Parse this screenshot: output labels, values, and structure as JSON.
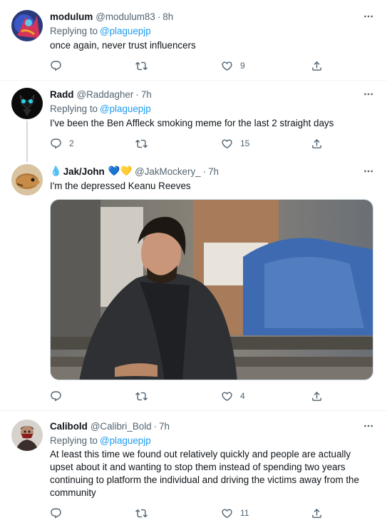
{
  "tweets": [
    {
      "name": "modulum",
      "handle": "@modulum83",
      "time": "8h",
      "replying_prefix": "Replying to",
      "replying_to": "@plaguepjp",
      "text": "once again, never trust influencers",
      "replies": "",
      "retweets": "",
      "likes": "9"
    },
    {
      "name": "Radd",
      "handle": "@Raddagher",
      "time": "7h",
      "replying_prefix": "Replying to",
      "replying_to": "@plaguepjp",
      "text": "I've been the Ben Affleck smoking meme for the last 2 straight days",
      "replies": "2",
      "retweets": "",
      "likes": "15"
    },
    {
      "name_prefix_emoji": "💧",
      "name": "Jak/John",
      "name_suffix_emoji_1": "💙",
      "name_suffix_emoji_2": "💛",
      "handle": "@JakMockery_",
      "time": "7h",
      "text": "I'm the depressed Keanu Reeves",
      "replies": "",
      "retweets": "",
      "likes": "4"
    },
    {
      "name": "Calibold",
      "handle": "@Calibri_Bold",
      "time": "7h",
      "replying_prefix": "Replying to",
      "replying_to": "@plaguepjp",
      "text_lines": [
        "At least this time we found out relatively quickly and people are actually",
        "upset about it and wanting to stop them instead of spending two years",
        "continuing to platform the individual and driving the victims away from the",
        "community"
      ],
      "replies": "",
      "retweets": "",
      "likes": "11"
    }
  ],
  "separator": "·",
  "colors": {
    "accent": "#1d9bf0",
    "secondary_text": "#536471",
    "divider": "#eff3f4"
  },
  "icons": [
    "reply-icon",
    "retweet-icon",
    "like-icon",
    "share-icon",
    "more-icon"
  ]
}
